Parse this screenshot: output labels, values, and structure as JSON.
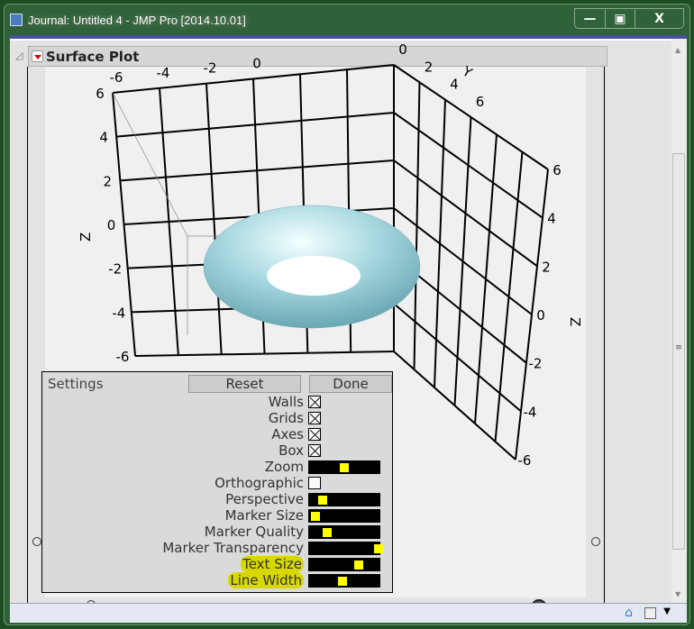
{
  "window": {
    "title": "Journal: Untitled 4 - JMP Pro [2014.10.01]",
    "minimize": "—",
    "maximize": "▣",
    "close": "X"
  },
  "outline": {
    "title": "Surface Plot"
  },
  "plot": {
    "ticks": [
      "-6",
      "-4",
      "-2",
      "0",
      "2",
      "4",
      "6"
    ],
    "axis_labels": {
      "z_left": "Z",
      "z_right": "Z",
      "y": "Y"
    }
  },
  "settings": {
    "title": "Settings",
    "reset": "Reset",
    "done": "Done",
    "checkboxes": [
      {
        "label": "Walls",
        "checked": true
      },
      {
        "label": "Grids",
        "checked": true
      },
      {
        "label": "Axes",
        "checked": true
      },
      {
        "label": "Box",
        "checked": true
      }
    ],
    "zoom": {
      "label": "Zoom",
      "value": 0.5
    },
    "orthographic": {
      "label": "Orthographic",
      "checked": false
    },
    "sliders": [
      {
        "label": "Perspective",
        "value": 0.15,
        "highlight": false
      },
      {
        "label": "Marker Size",
        "value": 0.04,
        "highlight": false
      },
      {
        "label": "Marker Quality",
        "value": 0.22,
        "highlight": false
      },
      {
        "label": "Marker Transparency",
        "value": 1.0,
        "highlight": false
      },
      {
        "label": "Text Size",
        "value": 0.7,
        "highlight": true
      },
      {
        "label": "Line Width",
        "value": 0.45,
        "highlight": true
      }
    ]
  },
  "colors": {
    "torus": "#a8d8e0",
    "highlight": "#d8d800",
    "knob": "#ffff00"
  }
}
